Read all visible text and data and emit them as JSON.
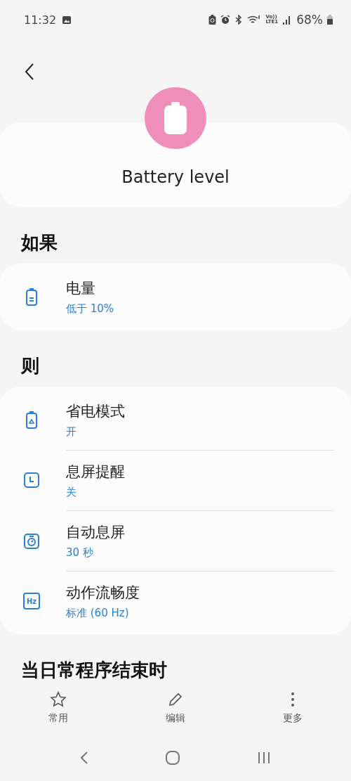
{
  "status_bar": {
    "time": "11:32",
    "volte_top": "Vo))",
    "volte_bottom": "LTE1",
    "battery": "68%"
  },
  "header": {
    "title": "Battery level"
  },
  "sections": [
    {
      "heading": "如果",
      "items": [
        {
          "kind": "battery",
          "title": "电量",
          "value": "低于 10%"
        }
      ]
    },
    {
      "heading": "则",
      "items": [
        {
          "kind": "battery-saver",
          "title": "省电模式",
          "value": "开"
        },
        {
          "kind": "clock",
          "title": "息屏提醒",
          "value": "关"
        },
        {
          "kind": "timer",
          "title": "自动息屏",
          "value": "30 秒"
        },
        {
          "kind": "hz",
          "badge": "Hz",
          "title": "动作流畅度",
          "value": "标准 (60 Hz)"
        }
      ]
    },
    {
      "heading": "当日常程序结束时"
    }
  ],
  "toolbar": [
    {
      "kind": "star",
      "label": "常用"
    },
    {
      "kind": "pencil",
      "label": "编辑"
    },
    {
      "kind": "more",
      "label": "更多"
    }
  ]
}
